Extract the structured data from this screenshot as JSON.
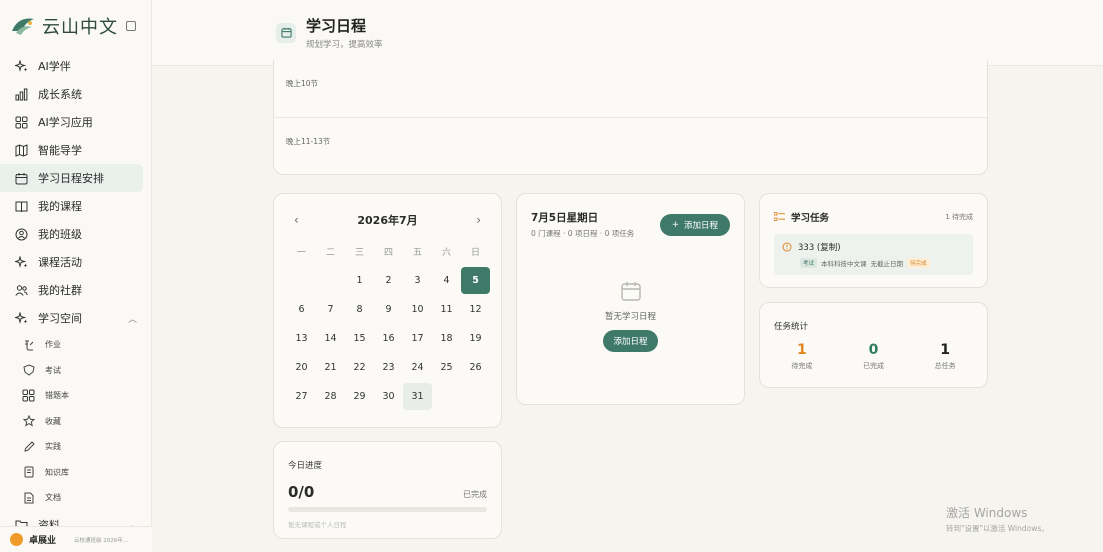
{
  "app": {
    "brand": "云山中文"
  },
  "sidebar": {
    "items": [
      {
        "label": "AI学伴",
        "icon": "sparkle-icon"
      },
      {
        "label": "成长系统",
        "icon": "bar-chart-icon"
      },
      {
        "label": "AI学习应用",
        "icon": "grid-icon"
      },
      {
        "label": "智能导学",
        "icon": "map-icon"
      },
      {
        "label": "学习日程安排",
        "icon": "calendar-icon",
        "active": true
      },
      {
        "label": "我的课程",
        "icon": "book-icon"
      },
      {
        "label": "我的班级",
        "icon": "badge-icon"
      },
      {
        "label": "课程活动",
        "icon": "sparkle-icon"
      },
      {
        "label": "我的社群",
        "icon": "users-icon"
      },
      {
        "label": "学习空间",
        "icon": "sparkle-icon",
        "expanded": true
      }
    ],
    "sub_items": [
      {
        "label": "作业",
        "icon": "homework-icon"
      },
      {
        "label": "考试",
        "icon": "shield-icon"
      },
      {
        "label": "错题本",
        "icon": "grid-icon"
      },
      {
        "label": "收藏",
        "icon": "star-icon"
      },
      {
        "label": "实践",
        "icon": "pencil-icon"
      },
      {
        "label": "知识库",
        "icon": "library-icon"
      },
      {
        "label": "文档",
        "icon": "document-icon"
      }
    ],
    "last_item": {
      "label": "资料",
      "icon": "folder-icon"
    },
    "user": {
      "name": "卓展业",
      "subtitle": "云校通班级 2026年..."
    }
  },
  "header": {
    "title": "学习日程",
    "subtitle": "规划学习，提高效率"
  },
  "timeline": {
    "slots": [
      "晚上10节",
      "晚上11-13节"
    ]
  },
  "calendar": {
    "title": "2026年7月",
    "weekdays": [
      "一",
      "二",
      "三",
      "四",
      "五",
      "六",
      "日"
    ],
    "leading_blanks": 2,
    "days": 31,
    "today": 5,
    "selected": 31
  },
  "progress": {
    "title": "今日进度",
    "count": "0/0",
    "status": "已完成",
    "fraction": 0,
    "note": "暂无课程或个人日程"
  },
  "schedule": {
    "date": "7月5日星期日",
    "meta": "0 门课程 · 0 项日程 · 0 项任务",
    "add_button": "添加日程",
    "empty_text": "暂无学习日程",
    "empty_button": "添加日程"
  },
  "tasks": {
    "title": "学习任务",
    "count": "1 待完成",
    "items": [
      {
        "name": "333 (复制)",
        "type_tag": "考试",
        "course": "本科科技中文课",
        "deadline": "无截止日期",
        "status_tag": "待完成"
      }
    ]
  },
  "stats": {
    "title": "任务统计",
    "items": [
      {
        "value": "1",
        "label": "待完成",
        "color": "#e0861f"
      },
      {
        "value": "0",
        "label": "已完成",
        "color": "#2e7d5f"
      },
      {
        "value": "1",
        "label": "总任务",
        "color": "#222222"
      }
    ]
  },
  "watermark": {
    "line1": "激活 Windows",
    "line2": "转到\"设置\"以激活 Windows。"
  }
}
